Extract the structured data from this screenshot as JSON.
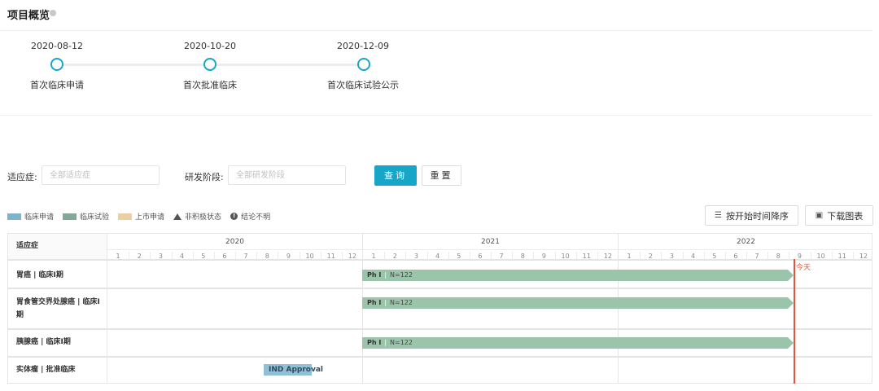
{
  "header": {
    "title": "项目概览"
  },
  "milestones": [
    {
      "date": "2020-08-12",
      "label": "首次临床申请"
    },
    {
      "date": "2020-10-20",
      "label": "首次批准临床"
    },
    {
      "date": "2020-12-09",
      "label": "首次临床试验公示"
    }
  ],
  "filters": {
    "indication_label": "适应症:",
    "indication_placeholder": "全部适应症",
    "phase_label": "研发阶段:",
    "phase_placeholder": "全部研发阶段",
    "query_button": "查询",
    "reset_button": "重置"
  },
  "legend": [
    {
      "label": "临床申请",
      "color": "#7eb3cc",
      "icon": "swatch"
    },
    {
      "label": "临床试验",
      "color": "#84a898",
      "icon": "swatch"
    },
    {
      "label": "上市申请",
      "color": "#ecd0a4",
      "icon": "swatch"
    },
    {
      "label": "非积极状态",
      "icon": "triangle-icon"
    },
    {
      "label": "结论不明",
      "icon": "info-icon"
    }
  ],
  "toolbar": {
    "sort_button": "按开始时间降序",
    "download_button": "下载图表"
  },
  "timeline": {
    "column_header": "适应症",
    "years": [
      "2020",
      "2021",
      "2022"
    ],
    "months": [
      "1",
      "2",
      "3",
      "4",
      "5",
      "6",
      "7",
      "8",
      "9",
      "10",
      "11",
      "12"
    ],
    "today_label": "今天",
    "rows": [
      {
        "label": "胃癌 | 临床I期",
        "bar": {
          "phase": "Ph I",
          "n": "N=122",
          "start": "2021-01",
          "end": "2022-08"
        }
      },
      {
        "label": "胃食管交界处腺癌 | 临床I期",
        "bar": {
          "phase": "Ph I",
          "n": "N=122",
          "start": "2021-01",
          "end": "2022-08"
        }
      },
      {
        "label": "胰腺癌 | 临床I期",
        "bar": {
          "phase": "Ph I",
          "n": "N=122",
          "start": "2021-01",
          "end": "2022-08"
        }
      },
      {
        "label": "实体瘤 | 批准临床",
        "bar": {
          "text": "IND Approval",
          "start": "2020-08",
          "end": "2020-10"
        }
      }
    ]
  },
  "colors": {
    "accent": "#17a6c8",
    "today": "#e2533a",
    "trial_bar": "#9bc5ab",
    "ind_bar": "#92bfd3"
  }
}
